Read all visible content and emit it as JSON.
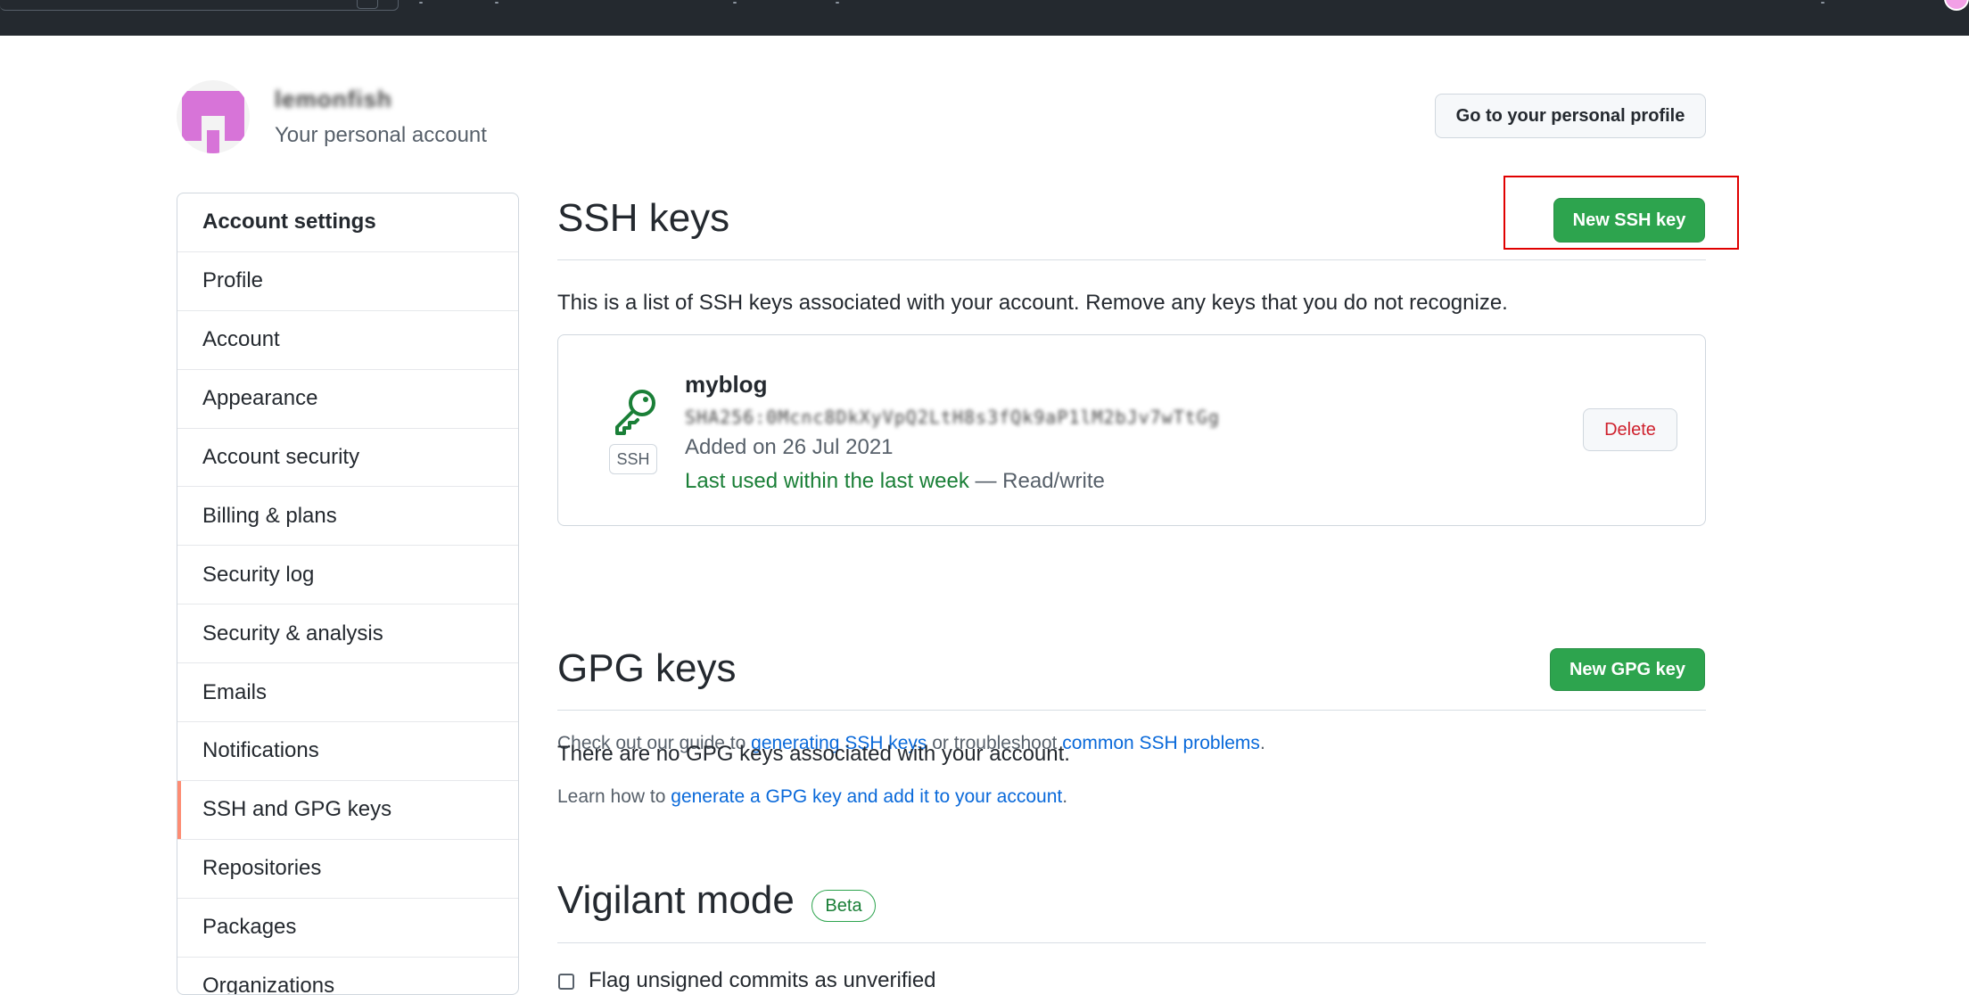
{
  "account": {
    "name": "lemonfish",
    "subtitle": "Your personal account",
    "profile_button": "Go to your personal profile"
  },
  "sidebar": {
    "items": [
      {
        "label": "Account settings"
      },
      {
        "label": "Profile"
      },
      {
        "label": "Account"
      },
      {
        "label": "Appearance"
      },
      {
        "label": "Account security"
      },
      {
        "label": "Billing & plans"
      },
      {
        "label": "Security log"
      },
      {
        "label": "Security & analysis"
      },
      {
        "label": "Emails"
      },
      {
        "label": "Notifications"
      },
      {
        "label": "SSH and GPG keys"
      },
      {
        "label": "Repositories"
      },
      {
        "label": "Packages"
      },
      {
        "label": "Organizations"
      }
    ],
    "active": "SSH and GPG keys"
  },
  "ssh": {
    "title": "SSH keys",
    "new_button": "New SSH key",
    "description": "This is a list of SSH keys associated with your account. Remove any keys that you do not recognize.",
    "keys": [
      {
        "title": "myblog",
        "fingerprint": "SHA256:0Mcnc8DkXyVpQ2LtH8s3fQk9aP1lM2bJv7wTtGg",
        "badge": "SSH",
        "added": "Added on 26 Jul 2021",
        "last_used": "Last used within the last week",
        "access": " — Read/write",
        "delete_button": "Delete"
      }
    ],
    "guide_prefix": "Check out our guide to ",
    "guide_link1": "generating SSH keys",
    "guide_mid": " or troubleshoot ",
    "guide_link2": "common SSH problems",
    "guide_suffix": "."
  },
  "gpg": {
    "title": "GPG keys",
    "new_button": "New GPG key",
    "empty": "There are no GPG keys associated with your account.",
    "learn_prefix": "Learn how to ",
    "learn_link": "generate a GPG key and add it to your account",
    "learn_suffix": "."
  },
  "vigilant": {
    "title": "Vigilant mode",
    "badge": "Beta",
    "checkbox_label": "Flag unsigned commits as unverified"
  },
  "colors": {
    "primary_green": "#2da44e",
    "link_blue": "#0969da",
    "danger_red": "#cf222e",
    "active_indicator": "#fd8c73",
    "highlight_red": "#e00000"
  }
}
